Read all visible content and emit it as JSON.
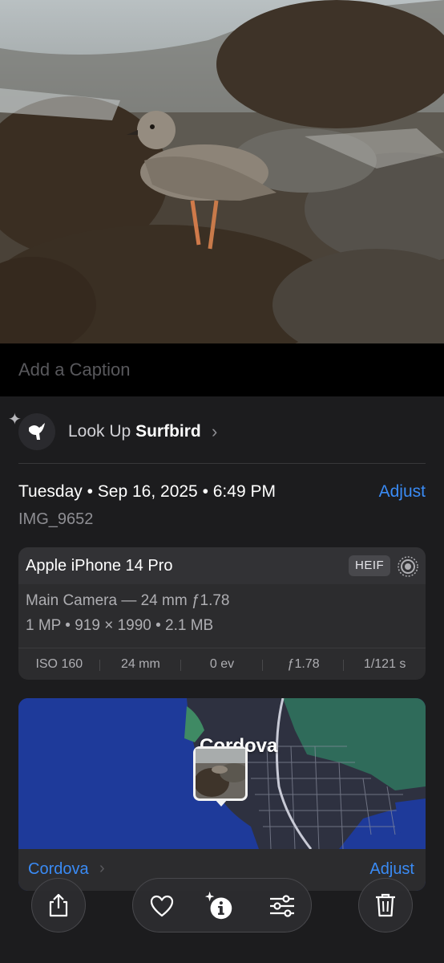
{
  "photo": {
    "subject": "bird-on-rocks"
  },
  "caption": {
    "placeholder": "Add a Caption"
  },
  "lookup": {
    "prefix": "Look Up",
    "subject": "Surfbird",
    "icon": "bird-icon"
  },
  "info": {
    "date": "Tuesday • Sep 16, 2025 • 6:49 PM",
    "adjust_label": "Adjust",
    "filename": "IMG_9652"
  },
  "camera": {
    "device": "Apple iPhone 14 Pro",
    "format_badge": "HEIF",
    "lens": "Main Camera — 24 mm ƒ1.78",
    "specs": "1 MP • 919 × 1990 • 2.1 MB",
    "exif": [
      "ISO 160",
      "24 mm",
      "0 ev",
      "ƒ1.78",
      "1/121 s"
    ]
  },
  "map": {
    "city_label": "Cordova",
    "location": "Cordova",
    "adjust_label": "Adjust"
  },
  "toolbar": {
    "share": "share-icon",
    "favorite": "heart-icon",
    "info": "info-sparkle-icon",
    "edit": "sliders-icon",
    "delete": "trash-icon"
  },
  "colors": {
    "accent": "#3a8bf5",
    "background": "#1c1c1e",
    "card": "#2c2c2e",
    "water": "#1e3a9a",
    "land": "#2f6b5a"
  }
}
